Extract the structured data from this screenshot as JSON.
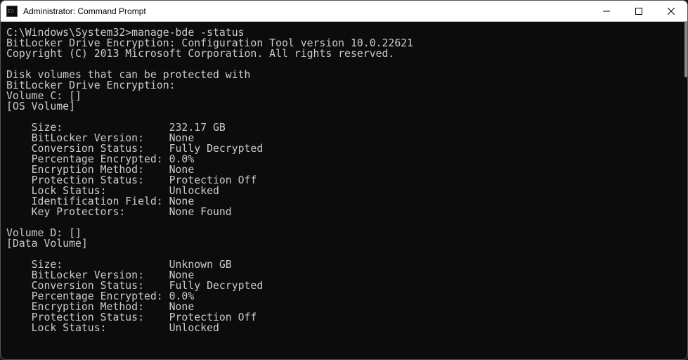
{
  "title": "Administrator: Command Prompt",
  "prompt_line": "C:\\Windows\\System32>manage-bde -status",
  "header1": "BitLocker Drive Encryption: Configuration Tool version 10.0.22621",
  "header2": "Copyright (C) 2013 Microsoft Corporation. All rights reserved.",
  "intro1": "Disk volumes that can be protected with",
  "intro2": "BitLocker Drive Encryption:",
  "vols": [
    {
      "name": "Volume C: []",
      "type": "[OS Volume]",
      "rows": [
        {
          "k": "Size:",
          "v": "232.17 GB"
        },
        {
          "k": "BitLocker Version:",
          "v": "None"
        },
        {
          "k": "Conversion Status:",
          "v": "Fully Decrypted"
        },
        {
          "k": "Percentage Encrypted:",
          "v": "0.0%"
        },
        {
          "k": "Encryption Method:",
          "v": "None"
        },
        {
          "k": "Protection Status:",
          "v": "Protection Off"
        },
        {
          "k": "Lock Status:",
          "v": "Unlocked"
        },
        {
          "k": "Identification Field:",
          "v": "None"
        },
        {
          "k": "Key Protectors:",
          "v": "None Found"
        }
      ]
    },
    {
      "name": "Volume D: []",
      "type": "[Data Volume]",
      "rows": [
        {
          "k": "Size:",
          "v": "Unknown GB"
        },
        {
          "k": "BitLocker Version:",
          "v": "None"
        },
        {
          "k": "Conversion Status:",
          "v": "Fully Decrypted"
        },
        {
          "k": "Percentage Encrypted:",
          "v": "0.0%"
        },
        {
          "k": "Encryption Method:",
          "v": "None"
        },
        {
          "k": "Protection Status:",
          "v": "Protection Off"
        },
        {
          "k": "Lock Status:",
          "v": "Unlocked"
        }
      ]
    }
  ]
}
